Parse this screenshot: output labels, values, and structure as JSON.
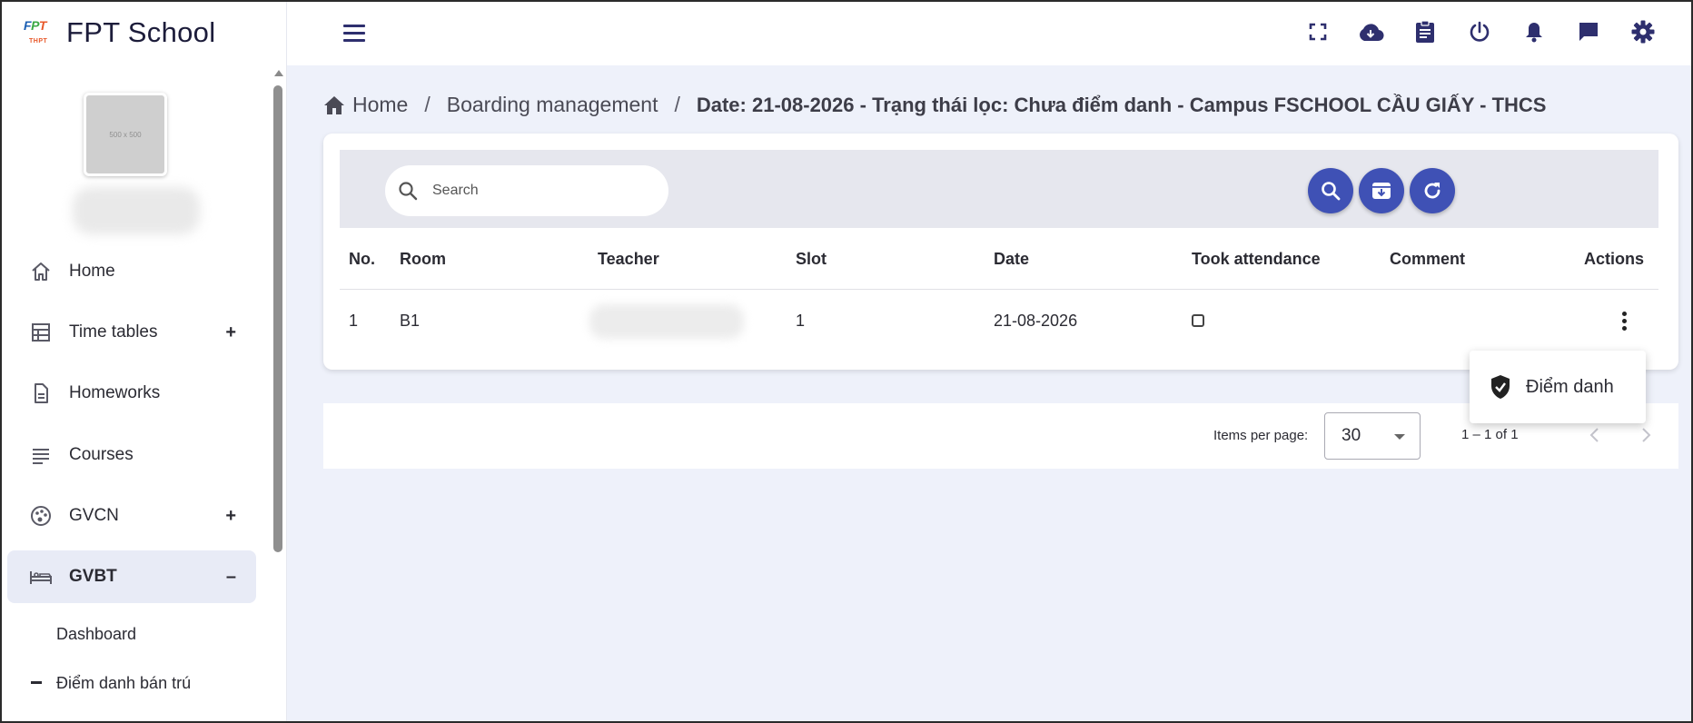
{
  "app": {
    "title": "FPT School",
    "logo_text": [
      "F",
      "P",
      "T"
    ],
    "logo_sub": "THPT"
  },
  "sidebar": {
    "avatar_placeholder": "500 x 500",
    "items": [
      {
        "label": "Home",
        "icon": "home-icon"
      },
      {
        "label": "Time tables",
        "icon": "table-icon",
        "expand": "+"
      },
      {
        "label": "Homeworks",
        "icon": "document-icon"
      },
      {
        "label": "Courses",
        "icon": "lines-icon"
      },
      {
        "label": "GVCN",
        "icon": "palette-icon",
        "expand": "+"
      },
      {
        "label": "GVBT",
        "icon": "bed-icon",
        "expand": "–",
        "active": true
      }
    ],
    "subitems": [
      {
        "label": "Dashboard"
      },
      {
        "label": "Điểm danh bán trú"
      }
    ]
  },
  "header": {
    "icons": [
      "fullscreen-icon",
      "cloud-download-icon",
      "clipboard-icon",
      "power-icon",
      "bell-icon",
      "chat-icon",
      "settings-icon"
    ]
  },
  "breadcrumb": {
    "home": "Home",
    "section": "Boarding management",
    "current": "Date: 21-08-2026 - Trạng thái lọc: Chưa điểm danh - Campus FSCHOOL CẦU GIẤY - THCS"
  },
  "toolbar": {
    "search_placeholder": "Search"
  },
  "table": {
    "columns": [
      "No.",
      "Room",
      "Teacher",
      "Slot",
      "Date",
      "Took attendance",
      "Comment",
      "Actions"
    ],
    "rows": [
      {
        "no": "1",
        "room": "B1",
        "teacher": "",
        "slot": "1",
        "date": "21-08-2026",
        "took_attendance": false,
        "comment": ""
      }
    ]
  },
  "popup_menu": {
    "items": [
      {
        "label": "Điểm danh",
        "icon": "shield-check-icon"
      }
    ]
  },
  "paginator": {
    "items_per_page_label": "Items per page:",
    "page_size": "30",
    "range": "1 – 1 of 1"
  },
  "colors": {
    "accent": "#3f51b5",
    "header_icons": "#2e2f6e",
    "background": "#eef1fa"
  }
}
